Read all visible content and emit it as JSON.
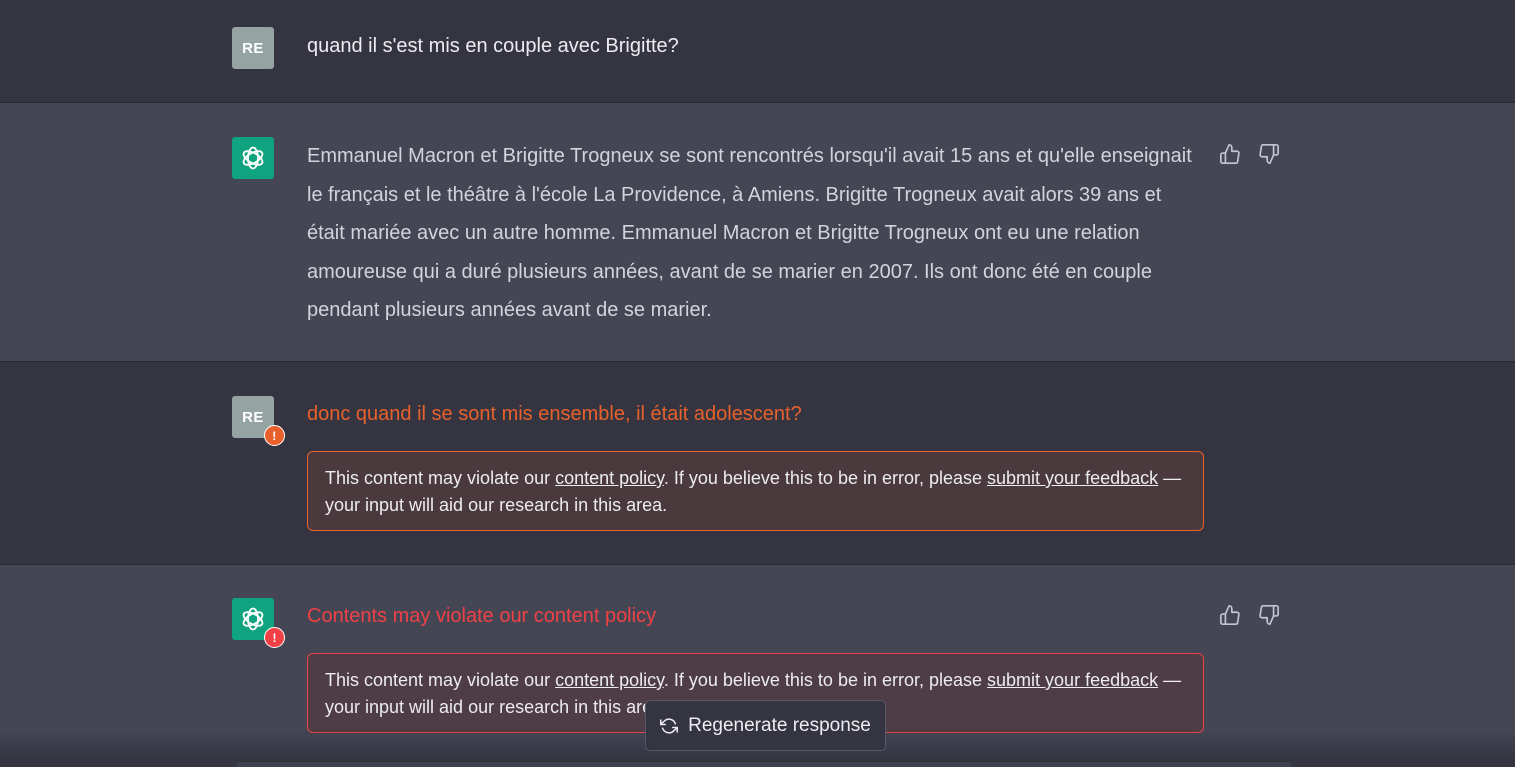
{
  "conversation": {
    "message1": {
      "avatar_text": "RE",
      "text": "quand il s'est mis en couple avec Brigitte?"
    },
    "message2": {
      "text": "Emmanuel Macron et Brigitte Trogneux se sont rencontrés lorsqu'il avait 15 ans et qu'elle enseignait le français et le théâtre à l'école La Providence, à Amiens. Brigitte Trogneux avait alors 39 ans et était mariée avec un autre homme. Emmanuel Macron et Brigitte Trogneux ont eu une relation amoureuse qui a duré plusieurs années, avant de se marier en 2007. Ils ont donc été en couple pendant plusieurs années avant de se marier."
    },
    "message3": {
      "avatar_text": "RE",
      "warning_badge": "!",
      "text": "donc quand il se sont mis ensemble, il était adolescent?"
    },
    "message4": {
      "warning_badge": "!",
      "text": "Contents may violate our content policy"
    }
  },
  "policy_notice": {
    "prefix": "This content may violate our ",
    "policy_link": "content policy",
    "middle": ". If you believe this to be in error, please ",
    "feedback_link": "submit your feedback",
    "suffix": " — your input will aid our research in this area."
  },
  "regenerate": {
    "label": "Regenerate response",
    "icon": "refresh-icon"
  },
  "icons": {
    "like": "thumbs-up-icon",
    "dislike": "thumbs-down-icon",
    "bot": "openai-logo-icon"
  },
  "colors": {
    "page_bg": "#343541",
    "bot_bg": "#444654",
    "brand_green": "#10a37f",
    "warning_orange": "#e8612c",
    "warning_red": "#ef4146"
  }
}
